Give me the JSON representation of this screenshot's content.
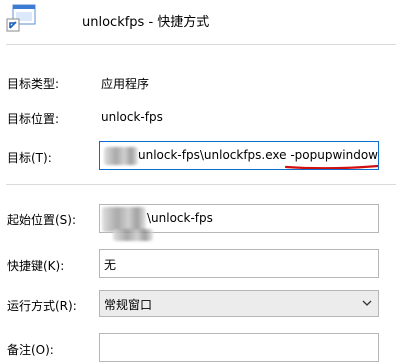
{
  "title": "unlockfps - 快捷方式",
  "rows": {
    "target_type": {
      "label": "目标类型:",
      "value": "应用程序"
    },
    "target_location": {
      "label": "目标位置:",
      "value": "unlock-fps"
    },
    "target": {
      "label": "目标(T):",
      "value": "unlock-fps\\unlockfps.exe -popupwindow"
    },
    "start_in": {
      "label": "起始位置(S):",
      "value": "\\unlock-fps"
    },
    "shortcut_key": {
      "label": "快捷键(K):",
      "value": "无"
    },
    "run": {
      "label": "运行方式(R):",
      "value": "常规窗口"
    },
    "comment": {
      "label": "备注(O):",
      "value": ""
    }
  },
  "colors": {
    "annotation_underline": "#d01010",
    "focus_border": "#0a6ed1"
  },
  "icons": {
    "app": "shortcut-app-icon",
    "dropdown": "chevron-down-icon"
  }
}
